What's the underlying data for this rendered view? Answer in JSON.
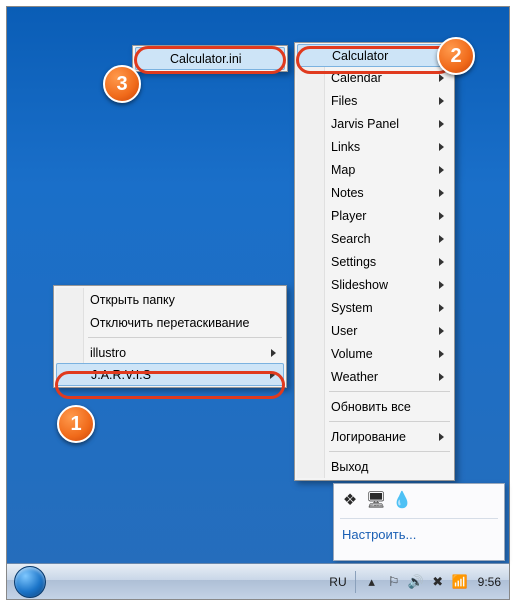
{
  "menu_left": {
    "items": [
      {
        "label": "Открыть папку",
        "arrow": false
      },
      {
        "label": "Отключить перетаскивание",
        "arrow": false
      },
      {
        "label": "illustro",
        "arrow": true
      },
      {
        "label": "J.A.R.V.I.S",
        "arrow": true,
        "highlight": true
      }
    ]
  },
  "menu_sub": {
    "items": [
      {
        "label": "Calculator",
        "arrow": true,
        "highlight": true
      },
      {
        "label": "Calendar",
        "arrow": true
      },
      {
        "label": "Files",
        "arrow": true
      },
      {
        "label": "Jarvis Panel",
        "arrow": true
      },
      {
        "label": "Links",
        "arrow": true
      },
      {
        "label": "Map",
        "arrow": true
      },
      {
        "label": "Notes",
        "arrow": true
      },
      {
        "label": "Player",
        "arrow": true
      },
      {
        "label": "Search",
        "arrow": true
      },
      {
        "label": "Settings",
        "arrow": true
      },
      {
        "label": "Slideshow",
        "arrow": true
      },
      {
        "label": "System",
        "arrow": true
      },
      {
        "label": "User",
        "arrow": true
      },
      {
        "label": "Volume",
        "arrow": true
      },
      {
        "label": "Weather",
        "arrow": true
      }
    ],
    "sep_after": 14,
    "tail": [
      {
        "label": "Обновить все",
        "arrow": false
      },
      {
        "label": "Логирование",
        "arrow": true
      },
      {
        "label": "Выход",
        "arrow": false
      }
    ],
    "sep2_after": 1
  },
  "menu_file": {
    "items": [
      {
        "label": "Calculator.ini",
        "arrow": false,
        "highlight": true
      }
    ]
  },
  "toolbar": {
    "customize": "Настроить..."
  },
  "tray": {
    "lang": "RU",
    "clock": "9:56"
  },
  "badges": {
    "b1": "1",
    "b2": "2",
    "b3": "3"
  }
}
